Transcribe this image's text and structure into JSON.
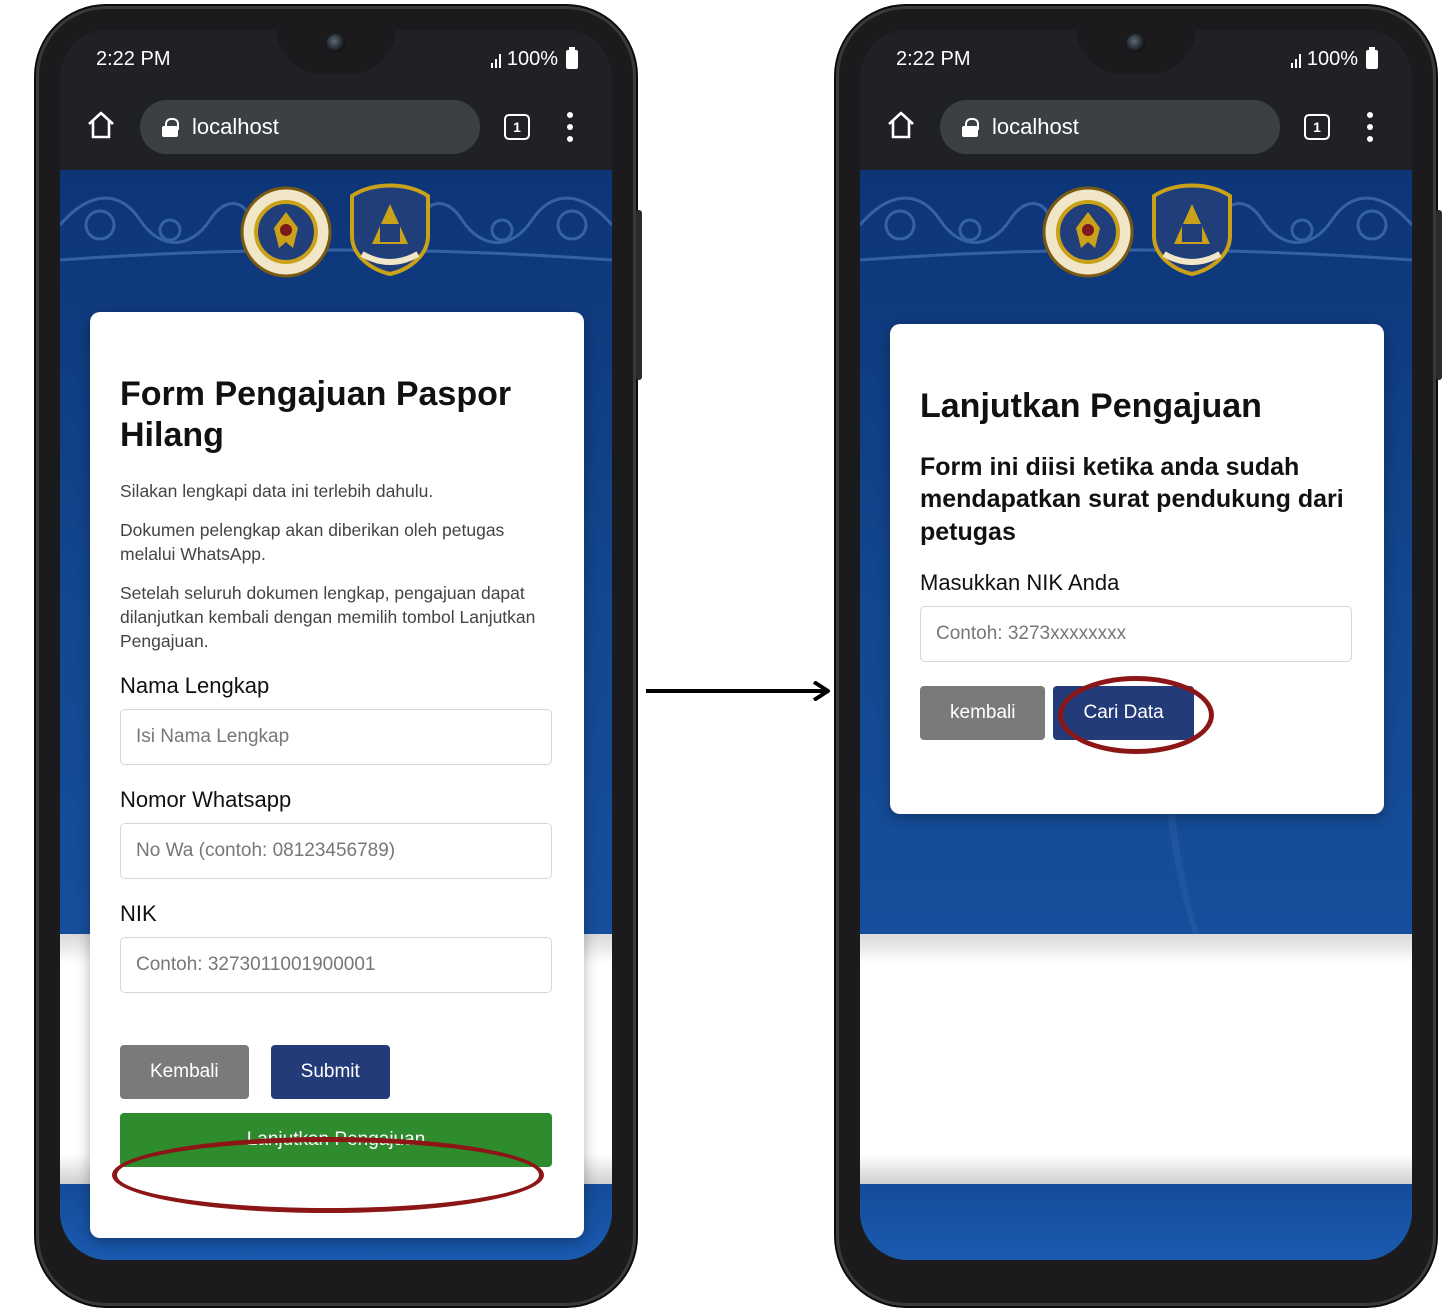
{
  "status": {
    "time": "2:22 PM",
    "battery": "100%"
  },
  "browser": {
    "url": "localhost",
    "tab_count": "1"
  },
  "left_screen": {
    "title": "Form Pengajuan Paspor Hilang",
    "paragraphs": [
      "Silakan lengkapi data ini terlebih dahulu.",
      "Dokumen pelengkap akan diberikan oleh petugas melalui WhatsApp.",
      "Setelah seluruh dokumen lengkap, pengajuan dapat dilanjutkan kembali dengan memilih tombol Lanjutkan Pengajuan."
    ],
    "fields": [
      {
        "label": "Nama Lengkap",
        "placeholder": "Isi Nama Lengkap"
      },
      {
        "label": "Nomor Whatsapp",
        "placeholder": "No Wa (contoh: 08123456789)"
      },
      {
        "label": "NIK",
        "placeholder": "Contoh: 3273011001900001"
      }
    ],
    "buttons": {
      "back": "Kembali",
      "submit": "Submit",
      "continue": "Lanjutkan Pengajuan"
    }
  },
  "right_screen": {
    "title": "Lanjutkan Pengajuan",
    "subtitle": "Form ini diisi ketika anda sudah mendapatkan surat pendukung dari petugas",
    "field_label": "Masukkan NIK Anda",
    "field_placeholder": "Contoh: 3273xxxxxxxx",
    "buttons": {
      "back": "kembali",
      "search": "Cari Data"
    }
  },
  "colors": {
    "page_blue": "#13478f",
    "button_navy": "#243b7a",
    "button_green": "#2e8b2e",
    "button_grey": "#7a7a7a",
    "highlight": "#8c1616"
  }
}
